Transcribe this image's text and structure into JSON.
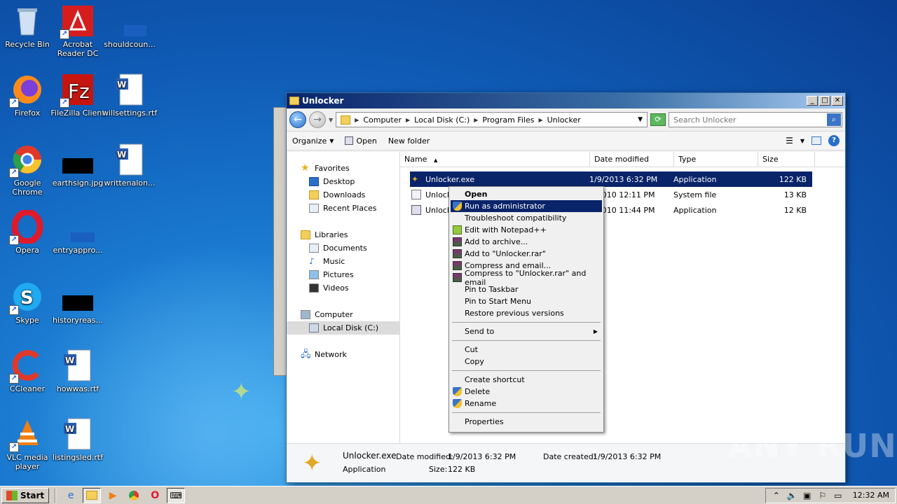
{
  "desktop": {
    "icons": [
      {
        "label": "Recycle Bin",
        "icon": "recycle-bin-icon"
      },
      {
        "label": "Acrobat Reader DC",
        "icon": "acrobat-icon"
      },
      {
        "label": "shouldcoun...",
        "icon": "file-icon"
      },
      {
        "label": "Firefox",
        "icon": "firefox-icon"
      },
      {
        "label": "FileZilla Client",
        "icon": "filezilla-icon"
      },
      {
        "label": "willsettings.rtf",
        "icon": "word-doc-icon"
      },
      {
        "label": "Google Chrome",
        "icon": "chrome-icon"
      },
      {
        "label": "earthsign.jpg",
        "icon": "image-file-icon"
      },
      {
        "label": "writtenalon...",
        "icon": "word-doc-icon"
      },
      {
        "label": "Opera",
        "icon": "opera-icon"
      },
      {
        "label": "entryappro...",
        "icon": "file-icon"
      },
      {
        "label": "Skype",
        "icon": "skype-icon"
      },
      {
        "label": "historyreas...",
        "icon": "image-file-icon"
      },
      {
        "label": "CCleaner",
        "icon": "ccleaner-icon"
      },
      {
        "label": "howwas.rtf",
        "icon": "word-doc-icon"
      },
      {
        "label": "VLC media player",
        "icon": "vlc-icon"
      },
      {
        "label": "listingsled.rtf",
        "icon": "word-doc-icon"
      }
    ]
  },
  "window": {
    "title": "Unlocker",
    "breadcrumb": [
      "Computer",
      "Local Disk (C:)",
      "Program Files",
      "Unlocker"
    ],
    "search_placeholder": "Search Unlocker",
    "toolbar": {
      "organize": "Organize",
      "open": "Open",
      "new_folder": "New folder"
    },
    "nav": {
      "favorites": "Favorites",
      "desktop": "Desktop",
      "downloads": "Downloads",
      "recent_places": "Recent Places",
      "libraries": "Libraries",
      "documents": "Documents",
      "music": "Music",
      "pictures": "Pictures",
      "videos": "Videos",
      "computer": "Computer",
      "local_disk": "Local Disk (C:)",
      "network": "Network"
    },
    "columns": {
      "name": "Name",
      "date": "Date modified",
      "type": "Type",
      "size": "Size"
    },
    "files": [
      {
        "name": "Unlocker.exe",
        "date": "1/9/2013 6:32 PM",
        "type": "Application",
        "size": "122 KB"
      },
      {
        "name": "Unlock",
        "date": "1/2010 12:11 PM",
        "type": "System file",
        "size": "13 KB"
      },
      {
        "name": "Unlock",
        "date": "4/2010 11:44 PM",
        "type": "Application",
        "size": "12 KB"
      }
    ],
    "details": {
      "name": "Unlocker.exe",
      "type": "Application",
      "date_modified_label": "Date modified:",
      "date_modified": "1/9/2013 6:32 PM",
      "date_created_label": "Date created:",
      "date_created": "1/9/2013 6:32 PM",
      "size_label": "Size:",
      "size": "122 KB"
    }
  },
  "context_menu": {
    "items": [
      "Open",
      "Run as administrator",
      "Troubleshoot compatibility",
      "Edit with Notepad++",
      "Add to archive...",
      "Add to \"Unlocker.rar\"",
      "Compress and email...",
      "Compress to \"Unlocker.rar\" and email",
      "Pin to Taskbar",
      "Pin to Start Menu",
      "Restore previous versions",
      "Send to",
      "Cut",
      "Copy",
      "Create shortcut",
      "Delete",
      "Rename",
      "Properties"
    ]
  },
  "taskbar": {
    "start": "Start",
    "clock": "12:32 AM"
  },
  "watermark": "ANY RUN"
}
